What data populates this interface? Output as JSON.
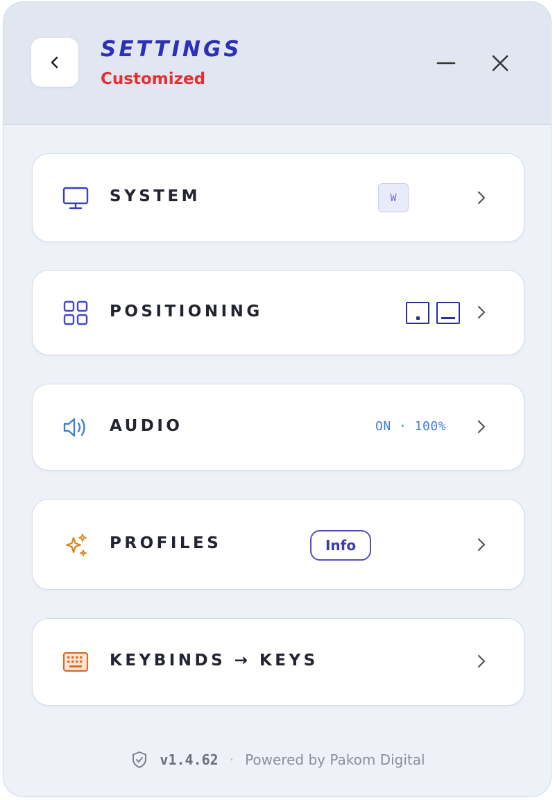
{
  "header": {
    "title": "SETTINGS",
    "subtitle": "Customized",
    "back_icon": "chevron-left-icon",
    "minimize_icon": "minimize-icon",
    "close_icon": "close-icon"
  },
  "menu": {
    "items": [
      {
        "label": "SYSTEM",
        "icon": "monitor-icon",
        "icon_color": "#3b3fc0",
        "badge": "W"
      },
      {
        "label": "POSITIONING",
        "icon": "grid-icon",
        "icon_color": "#4346c6",
        "badge": ""
      },
      {
        "label": "AUDIO",
        "icon": "speaker-icon",
        "icon_color": "#3d7fd6",
        "status": "ON · 100%"
      },
      {
        "label": "PROFILES",
        "icon": "sparkles-icon",
        "icon_color": "#e0821c",
        "pill": "Info"
      },
      {
        "label": "KEYBINDS → KEYS",
        "icon": "keyboard-icon",
        "icon_color": "#d86a2c"
      }
    ]
  },
  "footer": {
    "version": "v1.4.62",
    "separator": "·",
    "powered_by": "Powered by Pakom Digital",
    "icon": "shield-check-icon"
  }
}
